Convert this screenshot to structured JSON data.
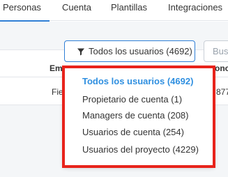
{
  "tabs": [
    {
      "label": "Personas"
    },
    {
      "label": "Cuenta"
    },
    {
      "label": "Plantillas"
    },
    {
      "label": "Integraciones"
    }
  ],
  "filter": {
    "label": "Todos los usuarios (4692)",
    "icon": "filter-icon"
  },
  "search": {
    "placeholder": "Busc"
  },
  "table": {
    "headers": {
      "email": "Em",
      "condition": "ono"
    },
    "rows": [
      {
        "name": "Fie",
        "number": "877"
      }
    ]
  },
  "dropdown": {
    "items": [
      {
        "label": "Todos los usuarios (4692)",
        "active": true
      },
      {
        "label": "Propietario de cuenta (1)",
        "active": false
      },
      {
        "label": "Managers de cuenta (208)",
        "active": false
      },
      {
        "label": "Usuarios de cuenta (254)",
        "active": false
      },
      {
        "label": "Usuarios del proyecto (4229)",
        "active": false
      }
    ]
  },
  "colors": {
    "accent": "#2f8fe0",
    "highlight": "#e8231b"
  }
}
